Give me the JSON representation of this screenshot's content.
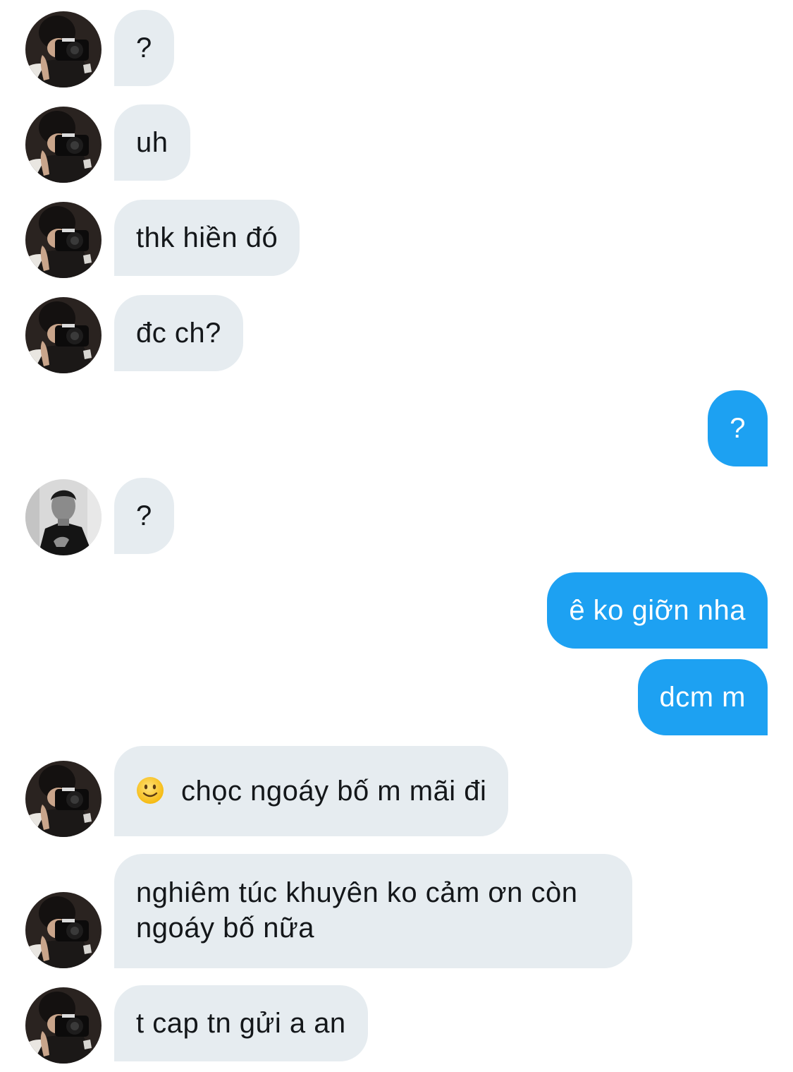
{
  "messages": [
    {
      "text": "?"
    },
    {
      "text": "uh"
    },
    {
      "text": "thk hiền đó"
    },
    {
      "text": "đc ch?"
    },
    {
      "text": "?"
    },
    {
      "text": "?"
    },
    {
      "text": "ê ko giỡn nha"
    },
    {
      "text": "dcm m"
    },
    {
      "text": "chọc ngoáy bố m mãi đi",
      "emoji": "slightly-smiling-face-icon"
    },
    {
      "text": "nghiêm túc khuyên ko cảm ơn còn ngoáy bố nữa"
    },
    {
      "text": "t cap tn gửi a an"
    }
  ],
  "colors": {
    "incoming_bubble": "#e6ecf0",
    "outgoing_bubble": "#1da1f2",
    "incoming_text": "#14171a",
    "outgoing_text": "#ffffff"
  }
}
